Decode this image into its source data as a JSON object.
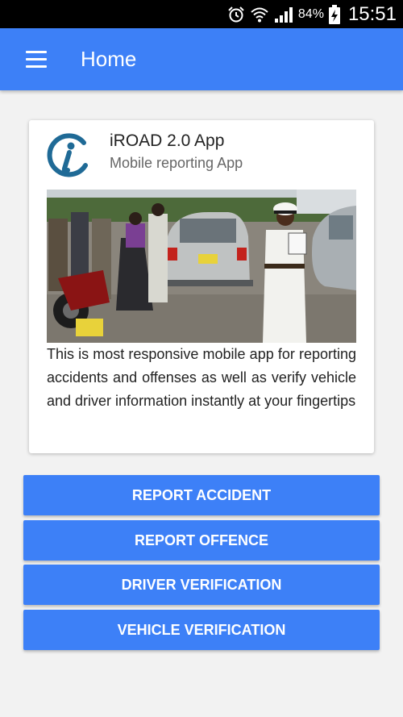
{
  "status_bar": {
    "battery_percent": "84%",
    "time": "15:51",
    "icons": [
      "alarm-icon",
      "wifi-icon",
      "signal-icon",
      "battery-charging-icon"
    ]
  },
  "app_bar": {
    "title": "Home",
    "menu_icon": "hamburger-menu-icon",
    "color": "#3d80f7"
  },
  "card": {
    "title": "iROAD 2.0 App",
    "subtitle": "Mobile reporting App",
    "logo_icon": "iroad-logo-icon",
    "image": "traffic-accident-scene-photo",
    "description": "This is most responsive mobile app for reporting accidents and offenses as well as verify vehicle and driver information instantly at your fingertips"
  },
  "actions": [
    {
      "label": "REPORT ACCIDENT"
    },
    {
      "label": "REPORT OFFENCE"
    },
    {
      "label": "DRIVER VERIFICATION"
    },
    {
      "label": "VEHICLE VERIFICATION"
    }
  ]
}
